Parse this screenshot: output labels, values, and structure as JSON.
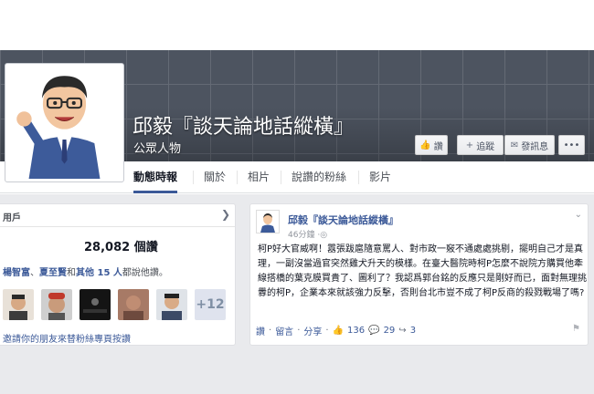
{
  "page": {
    "name": "邱毅『談天論地話縱橫』",
    "category": "公眾人物"
  },
  "cover_buttons": {
    "like_label": "讚",
    "follow_label": "追蹤",
    "message_label": "發訊息",
    "more_label": "•••"
  },
  "tabs": [
    {
      "label": "動態時報",
      "active": true
    },
    {
      "label": "關於"
    },
    {
      "label": "相片"
    },
    {
      "label": "說讚的粉絲"
    },
    {
      "label": "影片"
    }
  ],
  "likes_card": {
    "title": "用戶",
    "count": "28,082 個讚",
    "friend_1": "楊智富",
    "friend_2": "夏至賢",
    "and_text": "和",
    "others": "其他 15 人",
    "likers_suffix": "都說他讚。",
    "more_count": "+12",
    "invite_link": "邀請你的朋友來替粉絲專頁按讚"
  },
  "post": {
    "author": "邱毅『談天論地話縱橫』",
    "time": "46分鐘",
    "text": "柯P好大官威啊！囂張跋扈隨意罵人、對市政一竅不通處處挑剔，擺明自己才是真理，一副沒當過官突然雞犬升天的模樣。在臺大醫院時柯P怎麼不說院方購買他牽線搭橋的葉克膜買貴了、圖利了？我認爲郭台銘的反應只是剛好而已，面對無理挑釁的柯P，企業本來就該強力反擊，否則台北市豈不成了柯P反商的殺戮戰場了嗎?",
    "action_like": "讚",
    "action_comment": "留言",
    "action_share": "分享",
    "likes": "136",
    "comments": "29",
    "shares": "3"
  },
  "colors": {
    "fb_blue": "#3b5998",
    "cover": "#4d5460",
    "background": "#e9eaed"
  }
}
